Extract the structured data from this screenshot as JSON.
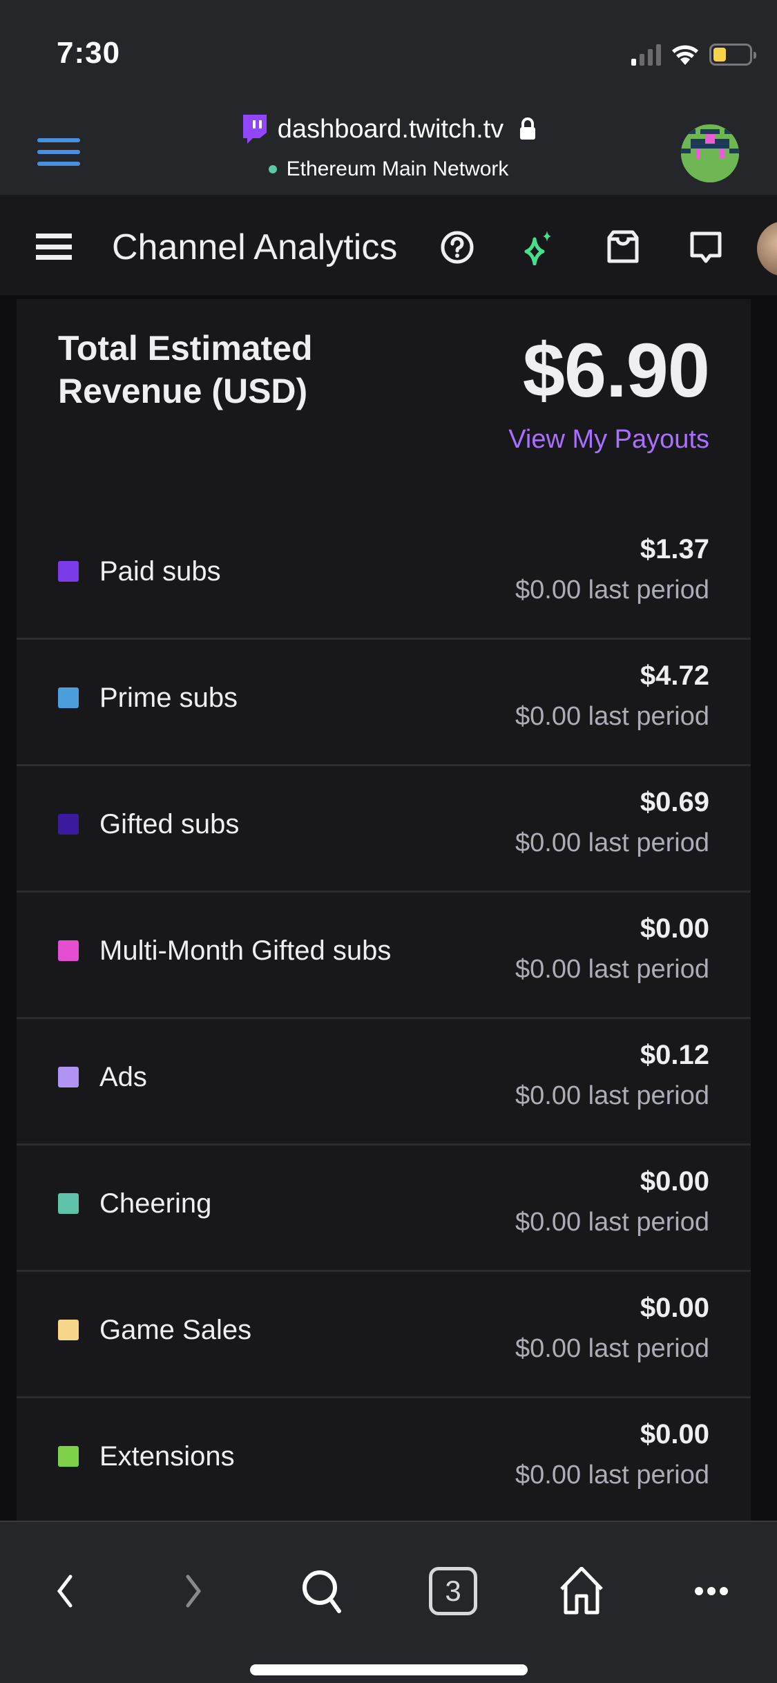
{
  "status_bar": {
    "time": "7:30",
    "battery_level": 0.35
  },
  "browser": {
    "url": "dashboard.twitch.tv",
    "network": "Ethereum Main Network",
    "open_tabs": "3",
    "icons": {
      "menu": "hamburger-icon",
      "site": "twitch-logo-icon",
      "secure": "lock-icon",
      "account": "pixel-avatar-icon",
      "back": "chevron-left-icon",
      "forward": "chevron-right-icon",
      "search": "search-icon",
      "tabs": "tabs-icon",
      "home": "home-icon",
      "more": "more-icon"
    }
  },
  "header": {
    "title": "Channel Analytics",
    "icons": [
      "hamburger-icon",
      "help-icon",
      "sparkle-icon",
      "inbox-icon",
      "whispers-icon",
      "profile-avatar"
    ]
  },
  "summary": {
    "label": "Total Estimated Revenue (USD)",
    "total": "$6.90",
    "payouts_link": "View My Payouts"
  },
  "colors": {
    "accent": "#a970ff",
    "background": "#18181b"
  },
  "revenue_rows": [
    {
      "label": "Paid subs",
      "value": "$1.37",
      "previous": "$0.00 last period",
      "color": "#7a3ce8"
    },
    {
      "label": "Prime subs",
      "value": "$4.72",
      "previous": "$0.00 last period",
      "color": "#4a9fdc"
    },
    {
      "label": "Gifted subs",
      "value": "$0.69",
      "previous": "$0.00 last period",
      "color": "#3b1a9e"
    },
    {
      "label": "Multi-Month Gifted subs",
      "value": "$0.00",
      "previous": "$0.00 last period",
      "color": "#e64ed1"
    },
    {
      "label": "Ads",
      "value": "$0.12",
      "previous": "$0.00 last period",
      "color": "#b193f5"
    },
    {
      "label": "Cheering",
      "value": "$0.00",
      "previous": "$0.00 last period",
      "color": "#5ec3a9"
    },
    {
      "label": "Game Sales",
      "value": "$0.00",
      "previous": "$0.00 last period",
      "color": "#f7d68a"
    },
    {
      "label": "Extensions",
      "value": "$0.00",
      "previous": "$0.00 last period",
      "color": "#7ed24a"
    }
  ]
}
